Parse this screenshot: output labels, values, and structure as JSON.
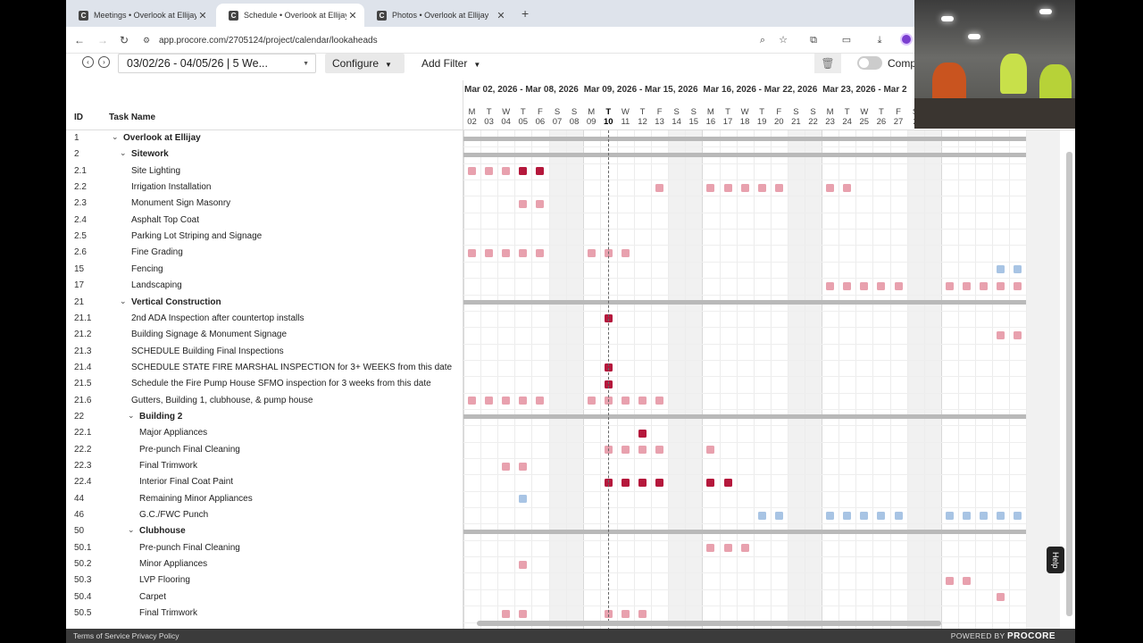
{
  "browser": {
    "tabs": [
      {
        "title": "Meetings • Overlook at Ellijay",
        "active": false
      },
      {
        "title": "Schedule • Overlook at Ellijay",
        "active": true
      },
      {
        "title": "Photos • Overlook at Ellijay",
        "active": false
      }
    ],
    "new_tab_glyph": "+",
    "url": "app.procore.com/2705124/project/calendar/lookaheads"
  },
  "toolbar": {
    "date_range": "03/02/26 - 04/05/26 | 5 We...",
    "configure_label": "Configure",
    "add_filter_label": "Add Filter",
    "toggle_label": "Comp"
  },
  "grid": {
    "columns": {
      "id": "ID",
      "task_name": "Task Name"
    },
    "weeks": [
      {
        "label": "Mar 02, 2026 - Mar 08, 2026"
      },
      {
        "label": "Mar 09, 2026 - Mar 15, 2026"
      },
      {
        "label": "Mar 16, 2026 - Mar 22, 2026"
      },
      {
        "label": "Mar 23, 2026 - Mar 2"
      }
    ],
    "day_letters": [
      "M",
      "T",
      "W",
      "T",
      "F",
      "S",
      "S",
      "M",
      "T",
      "W",
      "T",
      "F",
      "S",
      "S",
      "M",
      "T",
      "W",
      "T",
      "F",
      "S",
      "S",
      "M",
      "T",
      "W",
      "T",
      "F",
      "S"
    ],
    "day_numbers": [
      "02",
      "03",
      "04",
      "05",
      "06",
      "07",
      "08",
      "09",
      "10",
      "11",
      "12",
      "13",
      "14",
      "15",
      "16",
      "17",
      "18",
      "19",
      "20",
      "21",
      "22",
      "23",
      "24",
      "25",
      "26",
      "27",
      "2"
    ],
    "today_index": 8,
    "colors": {
      "light_red": "#e8a1ae",
      "dark_red": "#b5183c",
      "blue": "#a8c4e4",
      "summary": "#b9b9b9"
    },
    "rows": [
      {
        "id": "1",
        "name": "Overlook at Ellijay",
        "level": 0,
        "group": true,
        "summary": true,
        "marks": []
      },
      {
        "id": "2",
        "name": "Sitework",
        "level": 1,
        "group": true,
        "summary": true,
        "marks": []
      },
      {
        "id": "2.1",
        "name": "Site Lighting",
        "level": 2,
        "marks": [
          [
            0,
            "l"
          ],
          [
            1,
            "l"
          ],
          [
            2,
            "l"
          ],
          [
            3,
            "d"
          ],
          [
            4,
            "d"
          ]
        ]
      },
      {
        "id": "2.2",
        "name": "Irrigation Installation",
        "level": 2,
        "marks": [
          [
            11,
            "l"
          ],
          [
            14,
            "l"
          ],
          [
            15,
            "l"
          ],
          [
            16,
            "l"
          ],
          [
            17,
            "l"
          ],
          [
            18,
            "l"
          ],
          [
            21,
            "l"
          ],
          [
            22,
            "l"
          ]
        ]
      },
      {
        "id": "2.3",
        "name": "Monument Sign Masonry",
        "level": 2,
        "marks": [
          [
            3,
            "l"
          ],
          [
            4,
            "l"
          ]
        ]
      },
      {
        "id": "2.4",
        "name": "Asphalt Top Coat",
        "level": 2,
        "marks": []
      },
      {
        "id": "2.5",
        "name": "Parking Lot Striping and Signage",
        "level": 2,
        "marks": []
      },
      {
        "id": "2.6",
        "name": "Fine Grading",
        "level": 2,
        "marks": [
          [
            0,
            "l"
          ],
          [
            1,
            "l"
          ],
          [
            2,
            "l"
          ],
          [
            3,
            "l"
          ],
          [
            4,
            "l"
          ],
          [
            7,
            "l"
          ],
          [
            8,
            "l"
          ],
          [
            9,
            "l"
          ]
        ]
      },
      {
        "id": "15",
        "name": "Fencing",
        "level": 2,
        "marks": [
          [
            31,
            "b"
          ],
          [
            32,
            "b"
          ]
        ]
      },
      {
        "id": "17",
        "name": "Landscaping",
        "level": 2,
        "marks": [
          [
            21,
            "l"
          ],
          [
            22,
            "l"
          ],
          [
            23,
            "l"
          ],
          [
            24,
            "l"
          ],
          [
            25,
            "l"
          ],
          [
            28,
            "l"
          ],
          [
            29,
            "l"
          ],
          [
            30,
            "l"
          ],
          [
            31,
            "l"
          ],
          [
            32,
            "l"
          ]
        ]
      },
      {
        "id": "21",
        "name": "Vertical Construction",
        "level": 1,
        "group": true,
        "summary": true,
        "marks": []
      },
      {
        "id": "21.1",
        "name": "2nd ADA Inspection after countertop installs",
        "level": 2,
        "marks": [
          [
            8,
            "d"
          ]
        ]
      },
      {
        "id": "21.2",
        "name": "Building Signage & Monument Signage",
        "level": 2,
        "marks": [
          [
            31,
            "l"
          ],
          [
            32,
            "l"
          ]
        ]
      },
      {
        "id": "21.3",
        "name": "SCHEDULE Building Final Inspections",
        "level": 2,
        "marks": []
      },
      {
        "id": "21.4",
        "name": "SCHEDULE STATE FIRE MARSHAL INSPECTION for 3+ WEEKS from this date",
        "level": 2,
        "marks": [
          [
            8,
            "d"
          ]
        ]
      },
      {
        "id": "21.5",
        "name": "Schedule the Fire Pump House SFMO inspection for 3 weeks from this date",
        "level": 2,
        "marks": [
          [
            8,
            "d"
          ]
        ]
      },
      {
        "id": "21.6",
        "name": "Gutters, Building 1, clubhouse, & pump house",
        "level": 2,
        "marks": [
          [
            0,
            "l"
          ],
          [
            1,
            "l"
          ],
          [
            2,
            "l"
          ],
          [
            3,
            "l"
          ],
          [
            4,
            "l"
          ],
          [
            7,
            "l"
          ],
          [
            8,
            "l"
          ],
          [
            9,
            "l"
          ],
          [
            10,
            "l"
          ],
          [
            11,
            "l"
          ]
        ]
      },
      {
        "id": "22",
        "name": "Building 2",
        "level": 2,
        "group": true,
        "summary": true,
        "marks": []
      },
      {
        "id": "22.1",
        "name": "Major Appliances",
        "level": 3,
        "marks": [
          [
            10,
            "d"
          ]
        ]
      },
      {
        "id": "22.2",
        "name": "Pre-punch Final Cleaning",
        "level": 3,
        "marks": [
          [
            8,
            "l"
          ],
          [
            9,
            "l"
          ],
          [
            10,
            "l"
          ],
          [
            11,
            "l"
          ],
          [
            14,
            "l"
          ]
        ]
      },
      {
        "id": "22.3",
        "name": "Final Trimwork",
        "level": 3,
        "marks": [
          [
            2,
            "l"
          ],
          [
            3,
            "l"
          ]
        ]
      },
      {
        "id": "22.4",
        "name": "Interior Final Coat Paint",
        "level": 3,
        "marks": [
          [
            8,
            "d"
          ],
          [
            9,
            "d"
          ],
          [
            10,
            "d"
          ],
          [
            11,
            "d"
          ],
          [
            14,
            "d"
          ],
          [
            15,
            "d"
          ]
        ]
      },
      {
        "id": "44",
        "name": "Remaining Minor Appliances",
        "level": 3,
        "marks": [
          [
            3,
            "b"
          ]
        ]
      },
      {
        "id": "46",
        "name": "G.C./FWC Punch",
        "level": 3,
        "marks": [
          [
            17,
            "b"
          ],
          [
            18,
            "b"
          ],
          [
            21,
            "b"
          ],
          [
            22,
            "b"
          ],
          [
            23,
            "b"
          ],
          [
            24,
            "b"
          ],
          [
            25,
            "b"
          ],
          [
            28,
            "b"
          ],
          [
            29,
            "b"
          ],
          [
            30,
            "b"
          ],
          [
            31,
            "b"
          ],
          [
            32,
            "b"
          ]
        ]
      },
      {
        "id": "50",
        "name": "Clubhouse",
        "level": 2,
        "group": true,
        "summary": true,
        "marks": []
      },
      {
        "id": "50.1",
        "name": "Pre-punch Final Cleaning",
        "level": 3,
        "marks": [
          [
            14,
            "l"
          ],
          [
            15,
            "l"
          ],
          [
            16,
            "l"
          ]
        ]
      },
      {
        "id": "50.2",
        "name": "Minor Appliances",
        "level": 3,
        "marks": [
          [
            3,
            "l"
          ]
        ]
      },
      {
        "id": "50.3",
        "name": "LVP Flooring",
        "level": 3,
        "marks": [
          [
            28,
            "l"
          ],
          [
            29,
            "l"
          ]
        ]
      },
      {
        "id": "50.4",
        "name": "Carpet",
        "level": 3,
        "marks": [
          [
            31,
            "l"
          ]
        ]
      },
      {
        "id": "50.5",
        "name": "Final Trimwork",
        "level": 3,
        "marks": [
          [
            2,
            "l"
          ],
          [
            3,
            "l"
          ],
          [
            8,
            "l"
          ],
          [
            9,
            "l"
          ],
          [
            10,
            "l"
          ]
        ]
      }
    ]
  },
  "help_label": "Help",
  "footer": {
    "links": "Terms of Service  Privacy Policy",
    "powered_prefix": "POWERED BY",
    "brand": "PROCORE"
  }
}
